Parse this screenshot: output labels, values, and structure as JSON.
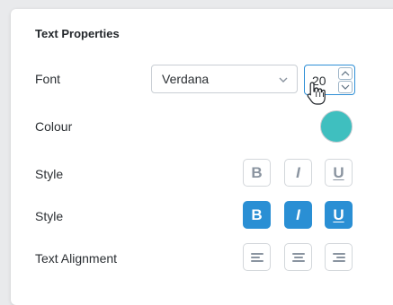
{
  "panel": {
    "title": "Text Properties"
  },
  "font": {
    "label": "Font",
    "selected": "Verdana",
    "size": "20"
  },
  "colour": {
    "label": "Colour",
    "value": "#3fbfbf"
  },
  "style_default": {
    "label": "Style",
    "bold": "B",
    "italic": "I",
    "underline": "U",
    "state": "inactive"
  },
  "style_active": {
    "label": "Style",
    "bold": "B",
    "italic": "I",
    "underline": "U",
    "state": "active"
  },
  "alignment": {
    "label": "Text Alignment",
    "options": [
      "align-left-icon",
      "align-center-icon",
      "align-right-icon"
    ]
  },
  "colors": {
    "accent": "#2a8fd4",
    "inactive_text": "#8a94a0",
    "border": "#d3d7db"
  }
}
